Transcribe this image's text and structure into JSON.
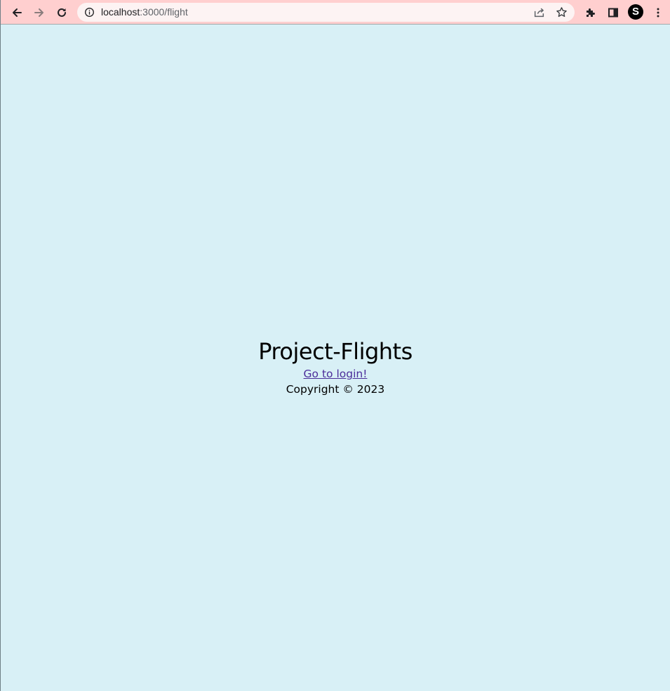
{
  "browser": {
    "url_host": "localhost",
    "url_path": ":3000/flight",
    "profile_initial": "S",
    "icons": {
      "back": "back-arrow-icon",
      "forward": "forward-arrow-icon",
      "reload": "reload-icon",
      "site_info": "info-icon",
      "share": "share-icon",
      "bookmark": "star-icon",
      "extensions": "puzzle-icon",
      "side_panel": "side-panel-icon",
      "menu": "kebab-menu-icon"
    }
  },
  "footer": {
    "brand": "Project-Flights",
    "login_link": "Go to login!",
    "copyright": "Copyright © 2023"
  },
  "colors": {
    "toolbar_bg": "#ffcfcf",
    "page_bg": "#d8f0f6",
    "link": "#4b2d9a"
  }
}
